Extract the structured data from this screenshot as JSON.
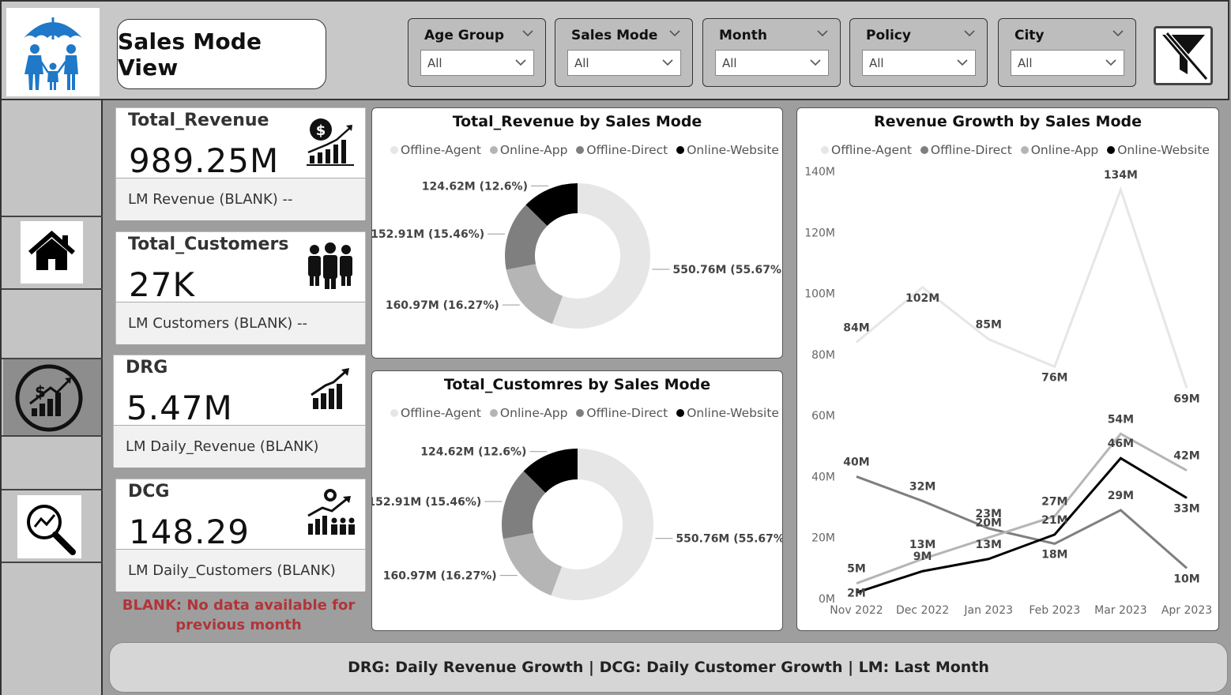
{
  "page": {
    "title": "Sales Mode View"
  },
  "filters": [
    {
      "label": "Age Group",
      "value": "All"
    },
    {
      "label": "Sales Mode",
      "value": "All"
    },
    {
      "label": "Month",
      "value": "All"
    },
    {
      "label": "Policy",
      "value": "All"
    },
    {
      "label": "City",
      "value": "All"
    }
  ],
  "kpis": [
    {
      "title": "Total_Revenue",
      "value": "989.25M",
      "sub": "LM Revenue (BLANK) --",
      "icon": "revenue-growth-icon"
    },
    {
      "title": "Total_Customers",
      "value": "27K",
      "sub": "LM Customers (BLANK) --",
      "icon": "customers-icon"
    },
    {
      "title": "DRG",
      "value": "5.47M",
      "sub": "LM Daily_Revenue (BLANK)",
      "icon": "bar-growth-icon"
    },
    {
      "title": "DCG",
      "value": "148.29",
      "sub": "LM Daily_Customers (BLANK)",
      "icon": "customer-growth-icon"
    }
  ],
  "note": {
    "line1": "BLANK: No data available for",
    "line2": "previous month"
  },
  "footer": {
    "text": "DRG: Daily Revenue Growth | DCG: Daily Customer Growth | LM: Last Month"
  },
  "colors": {
    "offline_agent": "#e6e6e6",
    "online_app": "#b5b5b5",
    "offline_direct": "#7f7f7f",
    "online_website": "#000000"
  },
  "chart_data": [
    {
      "type": "pie",
      "title": "Total_Revenue by Sales Mode",
      "legend": [
        "Offline-Agent",
        "Online-App",
        "Offline-Direct",
        "Online-Website"
      ],
      "slices": [
        {
          "name": "Offline-Agent",
          "value": 550.76,
          "label": "550.76M (55.67%)"
        },
        {
          "name": "Online-App",
          "value": 160.97,
          "label": "160.97M (16.27%)"
        },
        {
          "name": "Offline-Direct",
          "value": 152.91,
          "label": "152.91M (15.46%)"
        },
        {
          "name": "Online-Website",
          "value": 124.62,
          "label": "124.62M (12.6%)"
        }
      ]
    },
    {
      "type": "pie",
      "title": "Total_Customres by Sales Mode",
      "legend": [
        "Offline-Agent",
        "Online-App",
        "Offline-Direct",
        "Online-Website"
      ],
      "slices": [
        {
          "name": "Offline-Agent",
          "value": 550.76,
          "label": "550.76M (55.67%)"
        },
        {
          "name": "Online-App",
          "value": 160.97,
          "label": "160.97M (16.27%)"
        },
        {
          "name": "Offline-Direct",
          "value": 152.91,
          "label": "152.91M (15.46%)"
        },
        {
          "name": "Online-Website",
          "value": 124.62,
          "label": "124.62M (12.6%)"
        }
      ]
    },
    {
      "type": "line",
      "title": "Revenue Growth by Sales Mode",
      "legend": [
        "Offline-Agent",
        "Offline-Direct",
        "Online-App",
        "Online-Website"
      ],
      "categories": [
        "Nov 2022",
        "Dec 2022",
        "Jan 2023",
        "Feb 2023",
        "Mar 2023",
        "Apr 2023"
      ],
      "y_ticks": [
        "0M",
        "20M",
        "40M",
        "60M",
        "80M",
        "100M",
        "120M",
        "140M"
      ],
      "ylim": [
        0,
        140
      ],
      "series": [
        {
          "name": "Offline-Agent",
          "values": [
            84,
            102,
            85,
            76,
            134,
            69
          ],
          "labels": [
            "84M",
            "102M",
            "85M",
            "76M",
            "134M",
            "69M"
          ]
        },
        {
          "name": "Offline-Direct",
          "values": [
            40,
            32,
            23,
            18,
            29,
            10
          ],
          "labels": [
            "40M",
            "32M",
            "23M",
            "18M",
            "29M",
            "10M"
          ]
        },
        {
          "name": "Online-App",
          "values": [
            5,
            13,
            20,
            27,
            54,
            42
          ],
          "labels": [
            "5M",
            "13M",
            "20M",
            "27M",
            "54M",
            "42M"
          ]
        },
        {
          "name": "Online-Website",
          "values": [
            2,
            9,
            13,
            21,
            46,
            33
          ],
          "labels": [
            "2M",
            "9M",
            "13M",
            "21M",
            "46M",
            "33M"
          ]
        }
      ]
    }
  ]
}
